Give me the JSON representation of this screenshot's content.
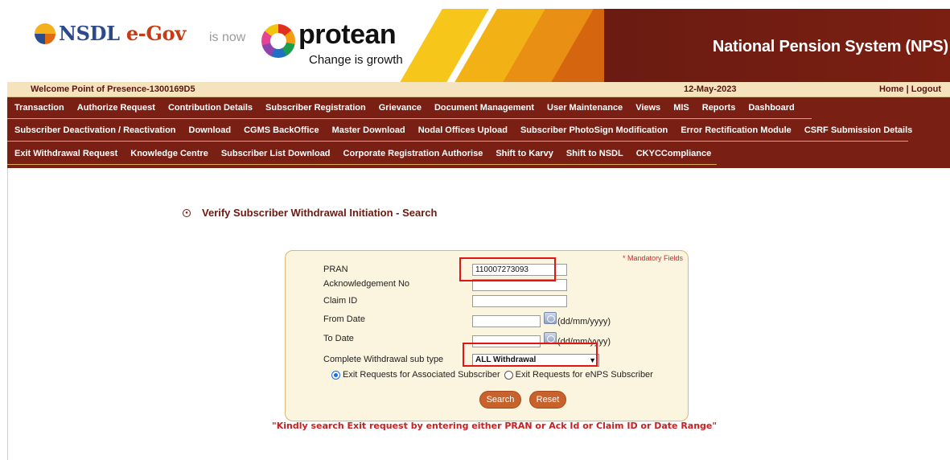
{
  "header": {
    "logo_nsdl": "NSDL",
    "logo_egov": "e-Gov",
    "is_now": "is now",
    "protean_name": "protean",
    "protean_tagline": "Change is growth",
    "system_title": "National Pension System (NPS)"
  },
  "welcome_bar": {
    "welcome_text": "Welcome Point of Presence-1300169D5",
    "date": "12-May-2023",
    "home_logout": "Home | Logout"
  },
  "menu": {
    "row1": [
      "Transaction",
      "Authorize Request",
      "Contribution Details",
      "Subscriber Registration",
      "Grievance",
      "Document Management",
      "User Maintenance",
      "Views",
      "MIS",
      "Reports",
      "Dashboard"
    ],
    "row2": [
      "Subscriber Deactivation / Reactivation",
      "Download",
      "CGMS BackOffice",
      "Master Download",
      "Nodal Offices Upload",
      "Subscriber PhotoSign Modification",
      "Error Rectification Module",
      "CSRF Submission Details"
    ],
    "row3": [
      "Exit Withdrawal Request",
      "Knowledge Centre",
      "Subscriber List Download",
      "Corporate Registration Authorise",
      "Shift to Karvy",
      "Shift to NSDL",
      "CKYCCompliance"
    ]
  },
  "page": {
    "heading": "Verify Subscriber Withdrawal Initiation - Search",
    "mandatory_note": "* Mandatory Fields",
    "fields": {
      "pran_label": "PRAN",
      "pran_value": "110007273093",
      "ack_label": "Acknowledgement No",
      "claim_label": "Claim ID",
      "from_label": "From Date",
      "to_label": "To Date",
      "date_format": "(dd/mm/yyyy)",
      "subtype_label": "Complete Withdrawal sub type",
      "subtype_value": "ALL Withdrawal"
    },
    "radio_associated": "Exit Requests for Associated Subscriber",
    "radio_enps": "Exit Requests for eNPS Subscriber",
    "search_button": "Search",
    "reset_button": "Reset",
    "hint": "\"Kindly search Exit request by entering either PRAN or Ack Id or Claim ID or Date Range\""
  },
  "colors": {
    "brand_maroon": "#7a1f14",
    "highlight": "#e51414",
    "button": "#c8622d"
  }
}
